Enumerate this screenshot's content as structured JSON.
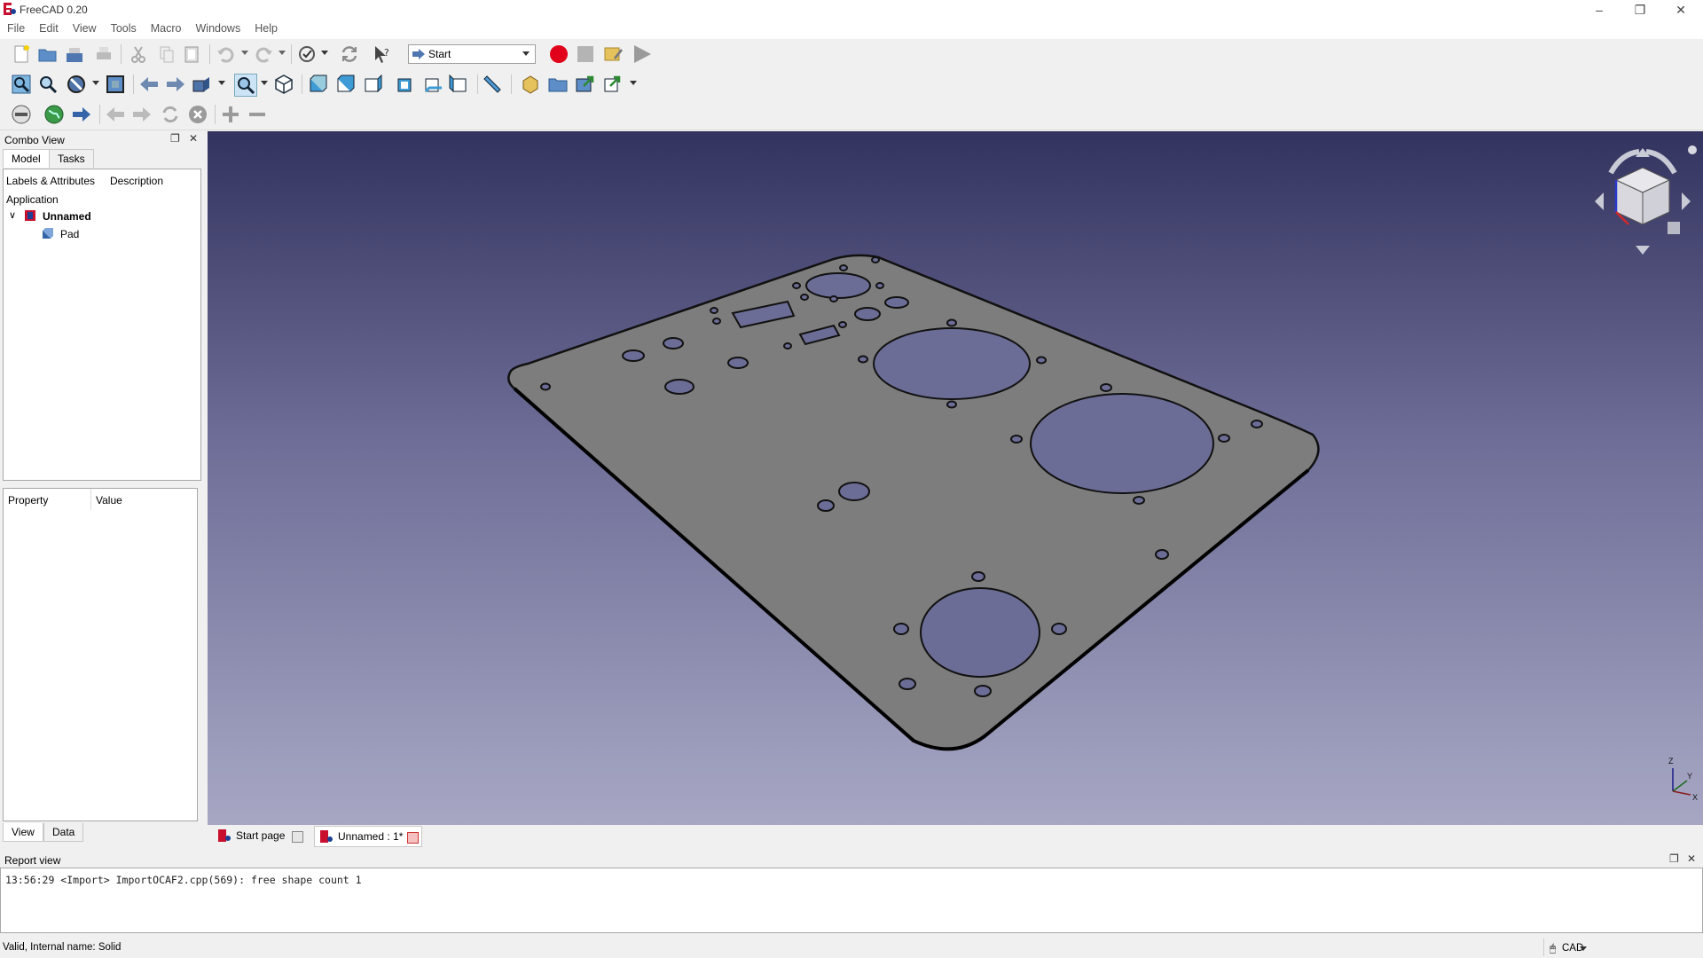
{
  "window": {
    "title": "FreeCAD 0.20",
    "minimize_icon": "minimize-icon",
    "restore_icon": "restore-icon",
    "close_icon": "close-icon"
  },
  "menubar": {
    "items": [
      "File",
      "Edit",
      "View",
      "Tools",
      "Macro",
      "Windows",
      "Help"
    ]
  },
  "toolbar": {
    "workbench_selected": "Start"
  },
  "combo_view": {
    "title": "Combo View",
    "tabs": [
      "Model",
      "Tasks"
    ],
    "active_tab": "Model",
    "tree": {
      "col_labels": "Labels & Attributes",
      "col_description": "Description",
      "root": "Application",
      "document": "Unnamed",
      "object": "Pad"
    },
    "property_editor": {
      "col_property": "Property",
      "col_value": "Value"
    },
    "bottom_tabs": [
      "View",
      "Data"
    ],
    "active_bottom_tab": "View"
  },
  "document_tabs": [
    {
      "label": "Start page"
    },
    {
      "label": "Unnamed : 1*"
    }
  ],
  "report_view": {
    "title": "Report view",
    "line": "13:56:29  <Import> ImportOCAF2.cpp(569): free shape count 1"
  },
  "status": {
    "message": "Valid, Internal name: Solid",
    "navigation_style": "CAD"
  },
  "axis_labels": {
    "z": "Z",
    "y": "Y",
    "x": "X"
  },
  "colors": {
    "viewport_top": "#33335f",
    "viewport_bottom": "#a7a7c4",
    "part": "#7f7f7f",
    "record_red": "#e0001a"
  }
}
